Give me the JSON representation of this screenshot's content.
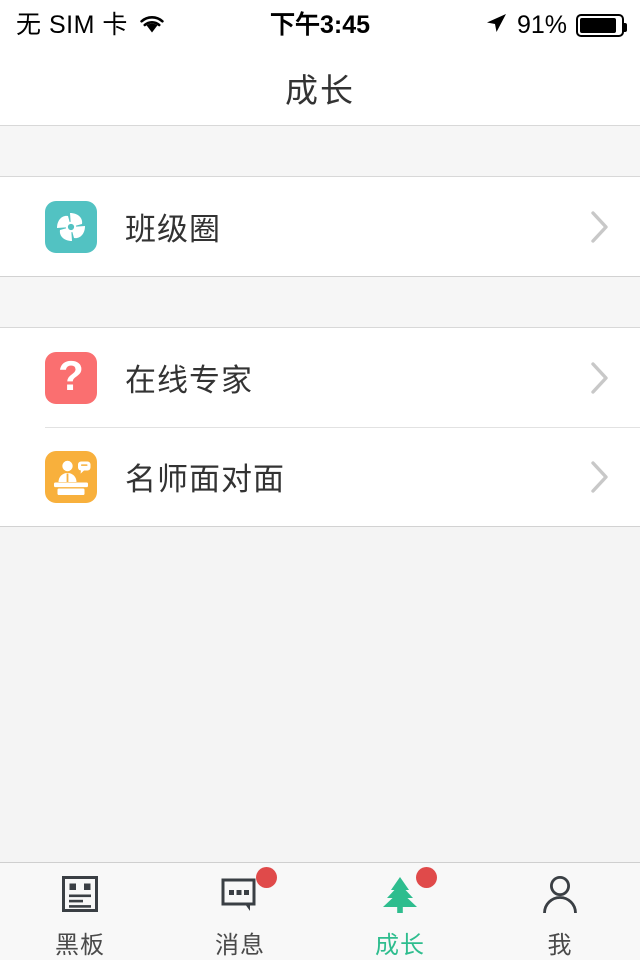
{
  "status_bar": {
    "carrier": "无 SIM 卡",
    "wifi_icon": "wifi-icon",
    "time": "下午3:45",
    "location_icon": "location-arrow-icon",
    "battery_percent": "91%",
    "battery_level": 91,
    "battery_icon": "battery-icon"
  },
  "nav": {
    "title": "成长"
  },
  "groups": [
    {
      "rows": [
        {
          "label": "班级圈",
          "icon_name": "pinwheel-icon",
          "icon_bg": "#52c2c2",
          "chevron_icon": "chevron-right-icon"
        }
      ]
    },
    {
      "rows": [
        {
          "label": "在线专家",
          "icon_name": "question-mark-icon",
          "icon_bg": "#fa6f70",
          "icon_glyph": "?",
          "chevron_icon": "chevron-right-icon"
        },
        {
          "label": "名师面对面",
          "icon_name": "lecturer-podium-icon",
          "icon_bg": "#f8b03c",
          "chevron_icon": "chevron-right-icon"
        }
      ]
    }
  ],
  "tab_bar": {
    "active_color": "#2ebd8e",
    "badge_color": "#e04a4a",
    "tabs": [
      {
        "label": "黑板",
        "icon_name": "blackboard-icon",
        "active": false,
        "badge": false
      },
      {
        "label": "消息",
        "icon_name": "chat-bubble-icon",
        "active": false,
        "badge": true
      },
      {
        "label": "成长",
        "icon_name": "pine-tree-icon",
        "active": true,
        "badge": true
      },
      {
        "label": "我",
        "icon_name": "person-icon",
        "active": false,
        "badge": false
      }
    ]
  }
}
